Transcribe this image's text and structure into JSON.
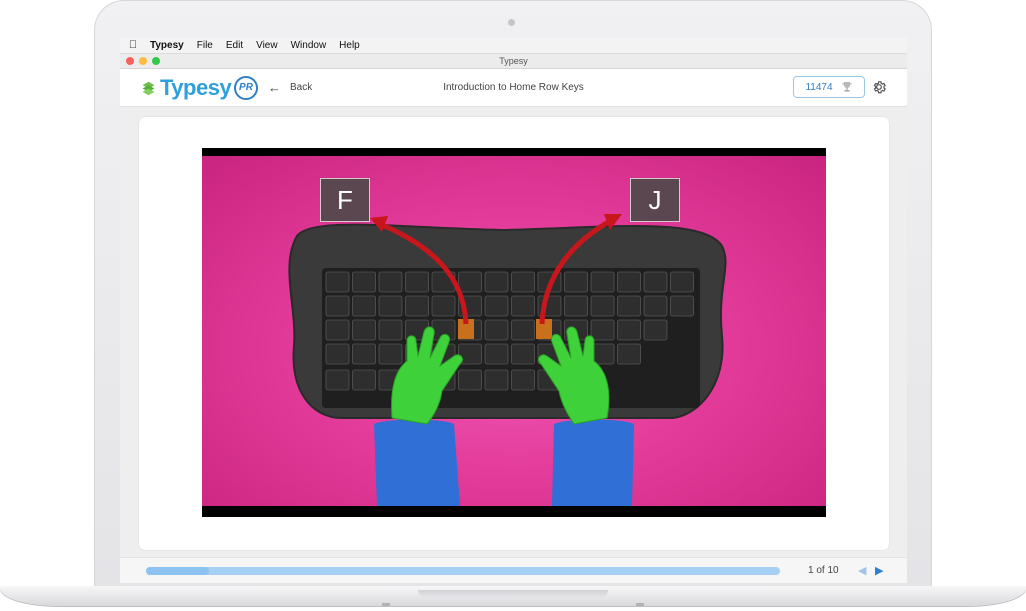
{
  "menubar": {
    "app_name": "Typesy",
    "items": [
      "File",
      "Edit",
      "View",
      "Window",
      "Help"
    ]
  },
  "window": {
    "title": "Typesy"
  },
  "header": {
    "logo_text": "Typesy",
    "badge_text": "PR",
    "back_label": "Back",
    "lesson_title": "Introduction to Home Row Keys",
    "score": "11474"
  },
  "video": {
    "left_key": "F",
    "right_key": "J"
  },
  "footer": {
    "page_indicator": "1 of 10",
    "progress_fraction": 0.1
  },
  "colors": {
    "brand_blue": "#2fa0db",
    "accent_blue": "#2f7fc3",
    "logo_green": "#6cc04a",
    "progress": "#a6d0f3"
  }
}
